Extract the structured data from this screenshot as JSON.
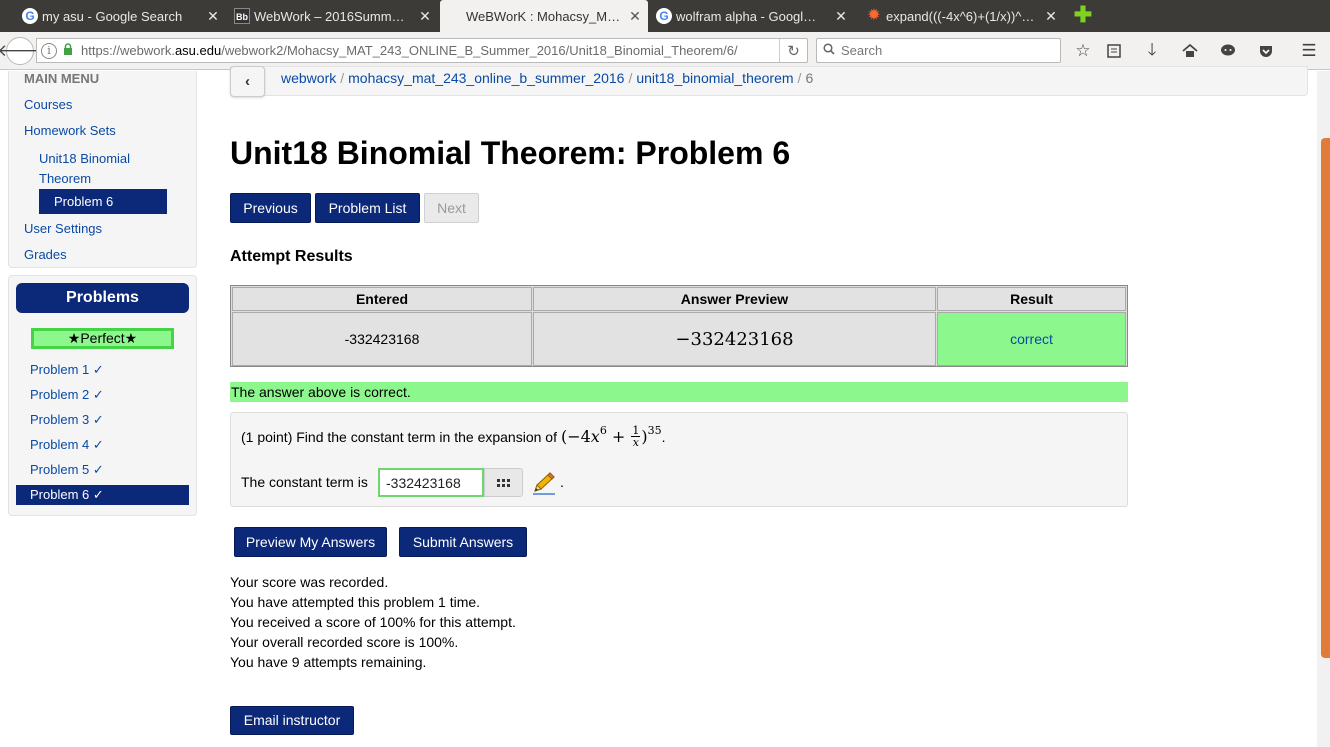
{
  "browser": {
    "tabs": [
      {
        "label": "my asu - Google Search",
        "favicon": "google-icon"
      },
      {
        "label": "WebWork – 2016Summ…",
        "favicon": "blackboard-icon"
      },
      {
        "label": "WeBWorK : Mohacsy_M…",
        "favicon": "none"
      },
      {
        "label": "wolfram alpha - Googl…",
        "favicon": "google-icon"
      },
      {
        "label": "expand(((-4x^6)+(1/x))^…",
        "favicon": "wolfram-icon"
      }
    ],
    "url_prefix": "https://webwork.",
    "url_domain": "asu.edu",
    "url_path": "/webwork2/Mohacsy_MAT_243_ONLINE_B_Summer_2016/Unit18_Binomial_Theorem/6/",
    "search_placeholder": "Search"
  },
  "sidebar": {
    "menu_header": "MAIN MENU",
    "items": {
      "courses": "Courses",
      "homework_sets": "Homework Sets",
      "set_name": "Unit18 Binomial Theorem",
      "set_name_line1": "Unit18 Binomial",
      "set_name_line2": "Theorem",
      "current_problem": "Problem 6",
      "user_settings": "User Settings",
      "grades": "Grades"
    }
  },
  "problems_panel": {
    "title": "Problems",
    "badge": "★Perfect★",
    "problems": [
      "Problem 1 ✓",
      "Problem 2 ✓",
      "Problem 3 ✓",
      "Problem 4 ✓",
      "Problem 5 ✓",
      "Problem 6 ✓"
    ]
  },
  "breadcrumb": {
    "items": [
      "webwork",
      "mohacsy_mat_243_online_b_summer_2016",
      "unit18_binomial_theorem"
    ],
    "current": "6"
  },
  "page": {
    "title": "Unit18 Binomial Theorem: Problem 6",
    "nav": {
      "previous": "Previous",
      "problem_list": "Problem List",
      "next": "Next"
    },
    "attempt_results_heading": "Attempt Results",
    "results_table": {
      "headers": [
        "Entered",
        "Answer Preview",
        "Result"
      ],
      "entered": "-332423168",
      "preview": "−332423168",
      "result": "correct"
    },
    "correct_message": "The answer above is correct.",
    "problem": {
      "points": "(1 point) Find the constant term in the expansion of",
      "expr_open": "(−4",
      "expr_var": "x",
      "expr_exp": "6",
      "expr_plus": " + ",
      "frac_num": "1",
      "frac_den": "x",
      "expr_close": ")",
      "outer_exp": "35",
      "end": ".",
      "answer_label": "The constant term is",
      "answer_value": "-332423168",
      "after": "."
    },
    "buttons": {
      "preview": "Preview My Answers",
      "submit": "Submit Answers"
    },
    "score_messages": [
      "Your score was recorded.",
      "You have attempted this problem 1 time.",
      "You received a score of 100% for this attempt.",
      "Your overall recorded score is 100%.",
      "You have 9 attempts remaining."
    ],
    "email_button": "Email instructor"
  },
  "colors": {
    "primary_button": "#0c2878",
    "correct_green": "#8cf78c",
    "link_blue": "#0a4aa5",
    "scroll_accent": "#e07b3a"
  }
}
